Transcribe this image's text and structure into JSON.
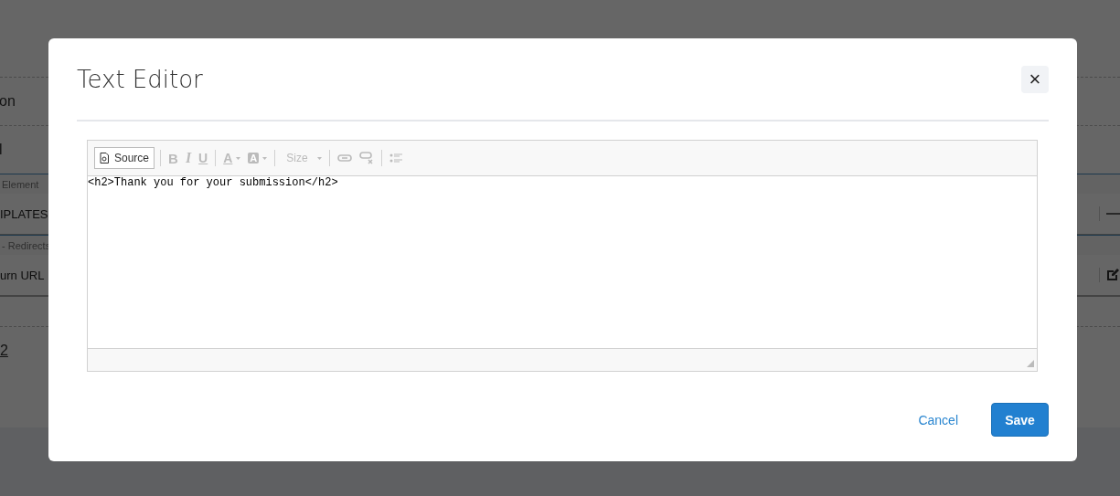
{
  "background": {
    "rows": [
      {
        "kind": "text",
        "text": "on"
      },
      {
        "kind": "text",
        "text": "l"
      },
      {
        "kind": "caption",
        "text": "Element"
      },
      {
        "kind": "fieldminus",
        "text": "IPLATES"
      },
      {
        "kind": "caption",
        "text": "- Redirects"
      },
      {
        "kind": "fieldedit",
        "text": "urn URL"
      },
      {
        "kind": "spacer"
      },
      {
        "kind": "link",
        "text": "2"
      }
    ]
  },
  "dialog": {
    "title": "Text Editor",
    "close_label": "×",
    "toolbar": [
      {
        "kind": "source",
        "label": "Source",
        "disabled": false
      },
      {
        "kind": "sep"
      },
      {
        "kind": "bold",
        "label": "B",
        "disabled": true
      },
      {
        "kind": "italic",
        "label": "I",
        "disabled": true
      },
      {
        "kind": "underline",
        "label": "U",
        "disabled": true
      },
      {
        "kind": "sep"
      },
      {
        "kind": "textcolor",
        "label": "A",
        "disabled": true
      },
      {
        "kind": "bgcolor",
        "label": "A",
        "disabled": true
      },
      {
        "kind": "sep"
      },
      {
        "kind": "size",
        "label": "Size",
        "disabled": true
      },
      {
        "kind": "sep"
      },
      {
        "kind": "link",
        "disabled": true
      },
      {
        "kind": "unlink",
        "disabled": true
      },
      {
        "kind": "sep"
      },
      {
        "kind": "list",
        "disabled": true
      }
    ],
    "source": "<h2>Thank you for your submission</h2>",
    "buttons": [
      {
        "kind": "cancel",
        "label": "Cancel"
      },
      {
        "kind": "save",
        "label": "Save"
      }
    ]
  }
}
